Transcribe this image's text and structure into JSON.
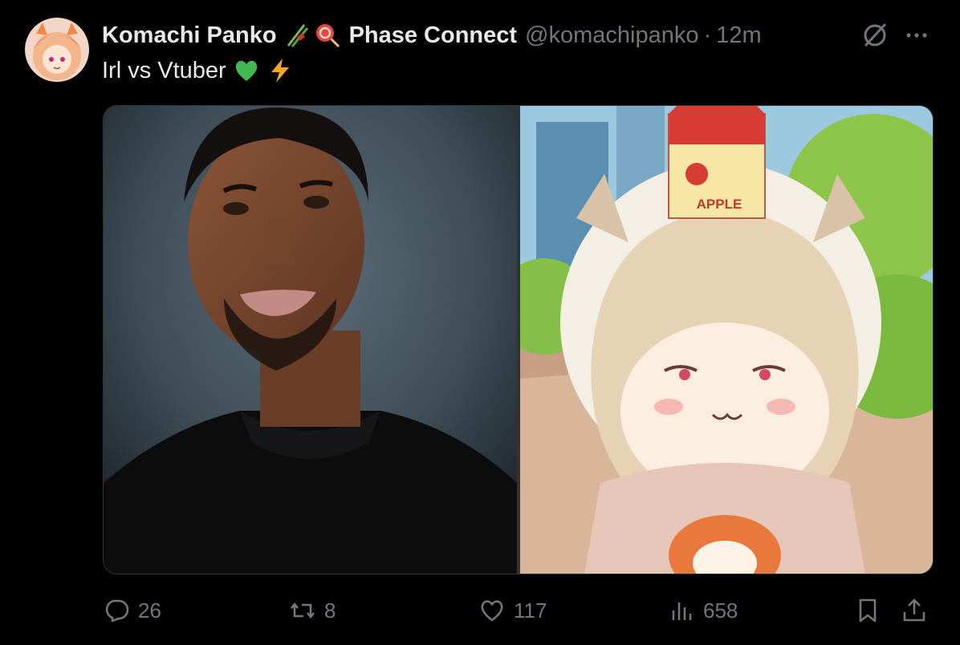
{
  "tweet": {
    "display_name": "Komachi Panko",
    "affiliation": "Phase Connect",
    "handle": "@komachipanko",
    "separator": "·",
    "time": "12m",
    "text": "Irl vs Vtuber",
    "name_emojis": [
      "chopsticks-emoji",
      "lollipop-emoji"
    ],
    "text_emojis": [
      "green-heart-emoji",
      "lightning-emoji"
    ],
    "media": [
      {
        "name": "photo-real-person"
      },
      {
        "name": "vtuber-avatar-art",
        "label": "APPLE"
      }
    ]
  },
  "actions": {
    "replies": "26",
    "reposts": "8",
    "likes": "117",
    "views": "658"
  },
  "colors": {
    "background": "#000000",
    "text": "#e7e9ea",
    "muted": "#71767b",
    "border": "#2f3336",
    "green_heart": "#3fb950",
    "lightning": "#f5a623"
  }
}
